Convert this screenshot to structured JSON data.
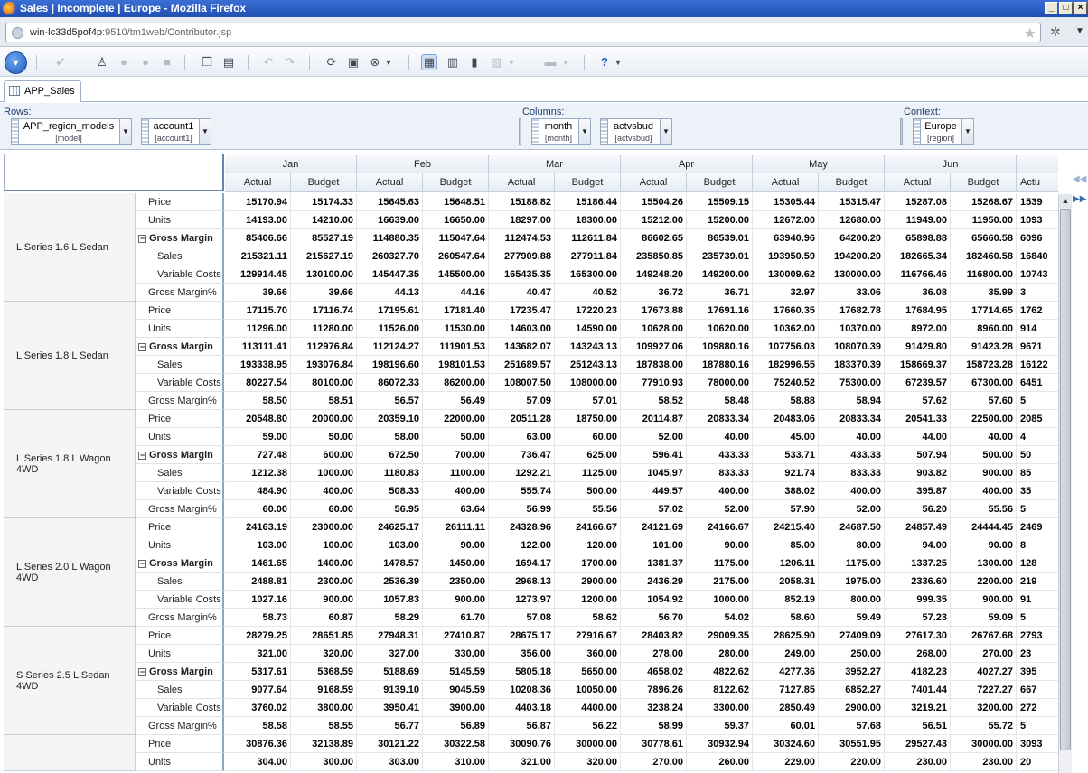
{
  "window": {
    "title": "Sales | Incomplete | Europe - Mozilla Firefox"
  },
  "urlbar": {
    "host": "win-lc33d5pof4p",
    "rest": ":9510/tm1web/Contributor.jsp"
  },
  "tab": {
    "label": "APP_Sales"
  },
  "dims": {
    "rows_label": "Rows:",
    "columns_label": "Columns:",
    "context_label": "Context:",
    "model": {
      "name": "APP_region_models",
      "sub": "[model]"
    },
    "account": {
      "name": "account1",
      "sub": "[account1]"
    },
    "month": {
      "name": "month",
      "sub": "[month]"
    },
    "version": {
      "name": "actvsbud",
      "sub": "[actvsbud]"
    },
    "region": {
      "name": "Europe",
      "sub": "[region]"
    }
  },
  "grid": {
    "months": [
      "Jan",
      "Feb",
      "Mar",
      "Apr",
      "May",
      "Jun",
      ""
    ],
    "subcols": [
      "Actual",
      "Budget",
      "Actual",
      "Budget",
      "Actual",
      "Budget",
      "Actual",
      "Budget",
      "Actual",
      "Budget",
      "Actual",
      "Budget",
      "Actu"
    ],
    "accounts": [
      "Price",
      "Units",
      "Gross Margin",
      "Sales",
      "Variable Costs",
      "Gross Margin%"
    ],
    "models": [
      {
        "name": "L Series 1.6 L Sedan",
        "rows": [
          [
            "15170.94",
            "15174.33",
            "15645.63",
            "15648.51",
            "15188.82",
            "15186.44",
            "15504.26",
            "15509.15",
            "15305.44",
            "15315.47",
            "15287.08",
            "15268.67",
            "1539"
          ],
          [
            "14193.00",
            "14210.00",
            "16639.00",
            "16650.00",
            "18297.00",
            "18300.00",
            "15212.00",
            "15200.00",
            "12672.00",
            "12680.00",
            "11949.00",
            "11950.00",
            "1093"
          ],
          [
            "85406.66",
            "85527.19",
            "114880.35",
            "115047.64",
            "112474.53",
            "112611.84",
            "86602.65",
            "86539.01",
            "63940.96",
            "64200.20",
            "65898.88",
            "65660.58",
            "6096"
          ],
          [
            "215321.11",
            "215627.19",
            "260327.70",
            "260547.64",
            "277909.88",
            "277911.84",
            "235850.85",
            "235739.01",
            "193950.59",
            "194200.20",
            "182665.34",
            "182460.58",
            "16840"
          ],
          [
            "129914.45",
            "130100.00",
            "145447.35",
            "145500.00",
            "165435.35",
            "165300.00",
            "149248.20",
            "149200.00",
            "130009.62",
            "130000.00",
            "116766.46",
            "116800.00",
            "10743"
          ],
          [
            "39.66",
            "39.66",
            "44.13",
            "44.16",
            "40.47",
            "40.52",
            "36.72",
            "36.71",
            "32.97",
            "33.06",
            "36.08",
            "35.99",
            "3"
          ]
        ]
      },
      {
        "name": "L Series 1.8 L Sedan",
        "rows": [
          [
            "17115.70",
            "17116.74",
            "17195.61",
            "17181.40",
            "17235.47",
            "17220.23",
            "17673.88",
            "17691.16",
            "17660.35",
            "17682.78",
            "17684.95",
            "17714.65",
            "1762"
          ],
          [
            "11296.00",
            "11280.00",
            "11526.00",
            "11530.00",
            "14603.00",
            "14590.00",
            "10628.00",
            "10620.00",
            "10362.00",
            "10370.00",
            "8972.00",
            "8960.00",
            "914"
          ],
          [
            "113111.41",
            "112976.84",
            "112124.27",
            "111901.53",
            "143682.07",
            "143243.13",
            "109927.06",
            "109880.16",
            "107756.03",
            "108070.39",
            "91429.80",
            "91423.28",
            "9671"
          ],
          [
            "193338.95",
            "193076.84",
            "198196.60",
            "198101.53",
            "251689.57",
            "251243.13",
            "187838.00",
            "187880.16",
            "182996.55",
            "183370.39",
            "158669.37",
            "158723.28",
            "16122"
          ],
          [
            "80227.54",
            "80100.00",
            "86072.33",
            "86200.00",
            "108007.50",
            "108000.00",
            "77910.93",
            "78000.00",
            "75240.52",
            "75300.00",
            "67239.57",
            "67300.00",
            "6451"
          ],
          [
            "58.50",
            "58.51",
            "56.57",
            "56.49",
            "57.09",
            "57.01",
            "58.52",
            "58.48",
            "58.88",
            "58.94",
            "57.62",
            "57.60",
            "5"
          ]
        ]
      },
      {
        "name": "L Series 1.8 L Wagon 4WD",
        "rows": [
          [
            "20548.80",
            "20000.00",
            "20359.10",
            "22000.00",
            "20511.28",
            "18750.00",
            "20114.87",
            "20833.34",
            "20483.06",
            "20833.34",
            "20541.33",
            "22500.00",
            "2085"
          ],
          [
            "59.00",
            "50.00",
            "58.00",
            "50.00",
            "63.00",
            "60.00",
            "52.00",
            "40.00",
            "45.00",
            "40.00",
            "44.00",
            "40.00",
            "4"
          ],
          [
            "727.48",
            "600.00",
            "672.50",
            "700.00",
            "736.47",
            "625.00",
            "596.41",
            "433.33",
            "533.71",
            "433.33",
            "507.94",
            "500.00",
            "50"
          ],
          [
            "1212.38",
            "1000.00",
            "1180.83",
            "1100.00",
            "1292.21",
            "1125.00",
            "1045.97",
            "833.33",
            "921.74",
            "833.33",
            "903.82",
            "900.00",
            "85"
          ],
          [
            "484.90",
            "400.00",
            "508.33",
            "400.00",
            "555.74",
            "500.00",
            "449.57",
            "400.00",
            "388.02",
            "400.00",
            "395.87",
            "400.00",
            "35"
          ],
          [
            "60.00",
            "60.00",
            "56.95",
            "63.64",
            "56.99",
            "55.56",
            "57.02",
            "52.00",
            "57.90",
            "52.00",
            "56.20",
            "55.56",
            "5"
          ]
        ]
      },
      {
        "name": "L Series 2.0 L Wagon 4WD",
        "rows": [
          [
            "24163.19",
            "23000.00",
            "24625.17",
            "26111.11",
            "24328.96",
            "24166.67",
            "24121.69",
            "24166.67",
            "24215.40",
            "24687.50",
            "24857.49",
            "24444.45",
            "2469"
          ],
          [
            "103.00",
            "100.00",
            "103.00",
            "90.00",
            "122.00",
            "120.00",
            "101.00",
            "90.00",
            "85.00",
            "80.00",
            "94.00",
            "90.00",
            "8"
          ],
          [
            "1461.65",
            "1400.00",
            "1478.57",
            "1450.00",
            "1694.17",
            "1700.00",
            "1381.37",
            "1175.00",
            "1206.11",
            "1175.00",
            "1337.25",
            "1300.00",
            "128"
          ],
          [
            "2488.81",
            "2300.00",
            "2536.39",
            "2350.00",
            "2968.13",
            "2900.00",
            "2436.29",
            "2175.00",
            "2058.31",
            "1975.00",
            "2336.60",
            "2200.00",
            "219"
          ],
          [
            "1027.16",
            "900.00",
            "1057.83",
            "900.00",
            "1273.97",
            "1200.00",
            "1054.92",
            "1000.00",
            "852.19",
            "800.00",
            "999.35",
            "900.00",
            "91"
          ],
          [
            "58.73",
            "60.87",
            "58.29",
            "61.70",
            "57.08",
            "58.62",
            "56.70",
            "54.02",
            "58.60",
            "59.49",
            "57.23",
            "59.09",
            "5"
          ]
        ]
      },
      {
        "name": "S Series 2.5 L Sedan 4WD",
        "rows": [
          [
            "28279.25",
            "28651.85",
            "27948.31",
            "27410.87",
            "28675.17",
            "27916.67",
            "28403.82",
            "29009.35",
            "28625.90",
            "27409.09",
            "27617.30",
            "26767.68",
            "2793"
          ],
          [
            "321.00",
            "320.00",
            "327.00",
            "330.00",
            "356.00",
            "360.00",
            "278.00",
            "280.00",
            "249.00",
            "250.00",
            "268.00",
            "270.00",
            "23"
          ],
          [
            "5317.61",
            "5368.59",
            "5188.69",
            "5145.59",
            "5805.18",
            "5650.00",
            "4658.02",
            "4822.62",
            "4277.36",
            "3952.27",
            "4182.23",
            "4027.27",
            "395"
          ],
          [
            "9077.64",
            "9168.59",
            "9139.10",
            "9045.59",
            "10208.36",
            "10050.00",
            "7896.26",
            "8122.62",
            "7127.85",
            "6852.27",
            "7401.44",
            "7227.27",
            "667"
          ],
          [
            "3760.02",
            "3800.00",
            "3950.41",
            "3900.00",
            "4403.18",
            "4400.00",
            "3238.24",
            "3300.00",
            "2850.49",
            "2900.00",
            "3219.21",
            "3200.00",
            "272"
          ],
          [
            "58.58",
            "58.55",
            "56.77",
            "56.89",
            "56.87",
            "56.22",
            "58.99",
            "59.37",
            "60.01",
            "57.68",
            "56.51",
            "55.72",
            "5"
          ]
        ]
      },
      {
        "name": "",
        "rows": [
          [
            "30876.36",
            "32138.89",
            "30121.22",
            "30322.58",
            "30090.76",
            "30000.00",
            "30778.61",
            "30932.94",
            "30324.60",
            "30551.95",
            "29527.43",
            "30000.00",
            "3093"
          ],
          [
            "304.00",
            "300.00",
            "303.00",
            "310.00",
            "321.00",
            "320.00",
            "270.00",
            "260.00",
            "229.00",
            "220.00",
            "230.00",
            "230.00",
            "20"
          ]
        ]
      }
    ]
  }
}
